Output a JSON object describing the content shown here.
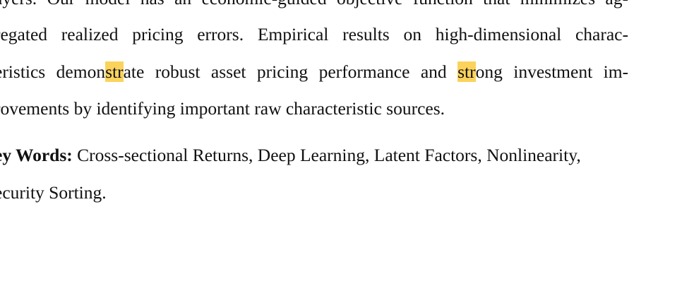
{
  "abstract": {
    "line0": "ayers. Our model has an economic-guided objective function that minimizes ag-",
    "line1": "regated realized pricing errors.  Empirical results on high-dimensional charac-",
    "line2": {
      "seg1": "eristics demon",
      "hl1": "str",
      "seg2": "ate robust asset pricing performance and ",
      "hl2": "str",
      "seg3": "ong investment im-"
    },
    "line3": "rovements by identifying important raw characteristic sources."
  },
  "keywords": {
    "label": "ey Words:",
    "text": " Cross-sectional Returns, Deep Learning, Latent Factors, Nonlinearity,",
    "continuation": "ecurity Sorting."
  },
  "colors": {
    "highlight": "#fbd35c",
    "text": "#111111",
    "background": "#ffffff"
  }
}
